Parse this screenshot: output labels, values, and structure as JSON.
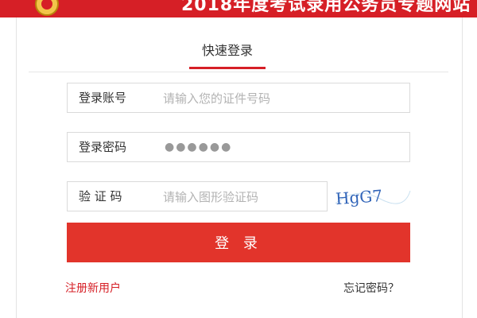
{
  "header": {
    "title": "2018年度考试录用公务员专题网站"
  },
  "login": {
    "tab_label": "快速登录",
    "account": {
      "label": "登录账号",
      "placeholder": "请输入您的证件号码"
    },
    "password": {
      "label": "登录密码",
      "value": "●●●●●●"
    },
    "captcha": {
      "label": "验 证 码",
      "placeholder": "请输入图形验证码",
      "image_text": "HgG7"
    },
    "submit_label": "登 录",
    "register_link": "注册新用户",
    "forgot_link": "忘记密码？"
  },
  "colors": {
    "accent": "#d61f26",
    "button": "#e2342b"
  }
}
